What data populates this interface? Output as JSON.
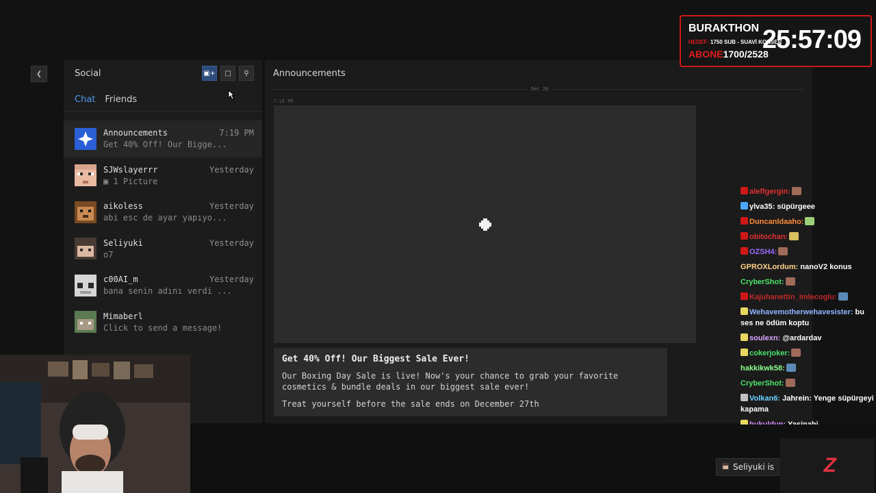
{
  "social": {
    "title": "Social",
    "tabs": [
      "Chat",
      "Friends"
    ],
    "buttons": [
      "add-friend-icon",
      "new-chat-icon",
      "search-icon"
    ],
    "chats": [
      {
        "name": "Announcements",
        "time": "7:19 PM",
        "preview": "Get 40% Off! Our Bigge..."
      },
      {
        "name": "SJWslayerrr",
        "time": "Yesterday",
        "preview": "▣ 1 Picture"
      },
      {
        "name": "aikoless",
        "time": "Yesterday",
        "preview": "abi esc de ayar yapıyo..."
      },
      {
        "name": "Seliyuki",
        "time": "Yesterday",
        "preview": "o7"
      },
      {
        "name": "c00AI_m",
        "time": "Yesterday",
        "preview": "bana senin adını verdi ..."
      },
      {
        "name": "Mimaberl",
        "time": "",
        "preview": "Click to send a message!"
      }
    ]
  },
  "announcement": {
    "title": "Announcements",
    "date": "Dec 26",
    "time": "7:18 PM",
    "message_title": "Get 40% Off! Our Biggest Sale Ever!",
    "message_body": "Our Boxing Day Sale is live! Now's your chance to grab your favorite cosmetics & bundle deals in our biggest sale ever!",
    "message_footer": "Treat yourself before the sale ends on December 27th"
  },
  "overlay": {
    "name": "BURAKTHON",
    "goal_label": "HEDEF:",
    "goal_text": "1750 SUB - SUAVİ KONSER",
    "subs_label": "ABONE",
    "subs_value": "1700/2528",
    "timer": "25:57:09"
  },
  "twitch_chat": [
    {
      "user": "aleffgergin:",
      "msg": "",
      "color": "#e03030"
    },
    {
      "user": "ylva35:",
      "msg": "süpürgeee",
      "color": "#ffffff"
    },
    {
      "user": "Duncanldaaho:",
      "msg": "",
      "color": "#ff8c3a"
    },
    {
      "user": "obitochan:",
      "msg": "",
      "color": "#e03030"
    },
    {
      "user": "OZSH4:",
      "msg": "",
      "color": "#9a6bff"
    },
    {
      "user": "GPROXLordum:",
      "msg": "nanoV2 konus",
      "color": "#ffd38a"
    },
    {
      "user": "CryberShot:",
      "msg": "",
      "color": "#4be36a"
    },
    {
      "user": "Kajuhanettin_Imlecoglu:",
      "msg": "",
      "color": "#c02a2a"
    },
    {
      "user": "Wehavemotherwehavesister:",
      "msg": "bu ses ne ödüm koptu",
      "color": "#8fb4ff"
    },
    {
      "user": "soulexn:",
      "msg": "@ardardav",
      "color": "#d9a6ff"
    },
    {
      "user": "cokerjoker:",
      "msg": "",
      "color": "#4be36a"
    },
    {
      "user": "hakkikwk58:",
      "msg": "",
      "color": "#8bff8b"
    },
    {
      "user": "CryberShot:",
      "msg": "",
      "color": "#4be36a"
    },
    {
      "user": "Volkan6:",
      "msg": "Jahrein: Yenge süpürgeyi kapama",
      "color": "#6ad2ff"
    },
    {
      "user": "bukuldun:",
      "msg": "Yasinabi",
      "color": "#d98cff"
    }
  ],
  "notification": {
    "text": "Seliyuki is"
  },
  "logo": "Z"
}
